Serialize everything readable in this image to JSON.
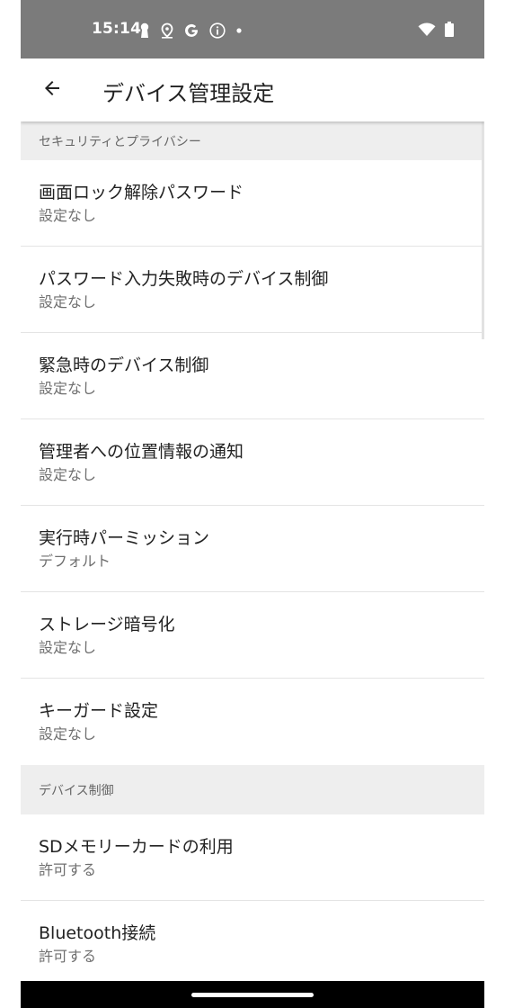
{
  "status_bar": {
    "time": "15:14",
    "left_icons": [
      "keyhole-icon",
      "location-pin-icon",
      "google-g-icon",
      "info-icon",
      "dot-icon"
    ],
    "right_icons": [
      "wifi-icon",
      "battery-icon"
    ],
    "background": "#7b7b7b"
  },
  "app_bar": {
    "back_icon": "arrow-left-icon",
    "title": "デバイス管理設定"
  },
  "sections": [
    {
      "header": "セキュリティとプライバシー",
      "items": [
        {
          "title": "画面ロック解除パスワード",
          "value": "設定なし"
        },
        {
          "title": "パスワード入力失敗時のデバイス制御",
          "value": "設定なし"
        },
        {
          "title": "緊急時のデバイス制御",
          "value": "設定なし"
        },
        {
          "title": "管理者への位置情報の通知",
          "value": "設定なし"
        },
        {
          "title": "実行時パーミッション",
          "value": "デフォルト"
        },
        {
          "title": "ストレージ暗号化",
          "value": "設定なし"
        },
        {
          "title": "キーガード設定",
          "value": "設定なし"
        }
      ]
    },
    {
      "header": "デバイス制御",
      "items": [
        {
          "title": "SDメモリーカードの利用",
          "value": "許可する"
        },
        {
          "title": "Bluetooth接続",
          "value": "許可する"
        }
      ]
    }
  ]
}
